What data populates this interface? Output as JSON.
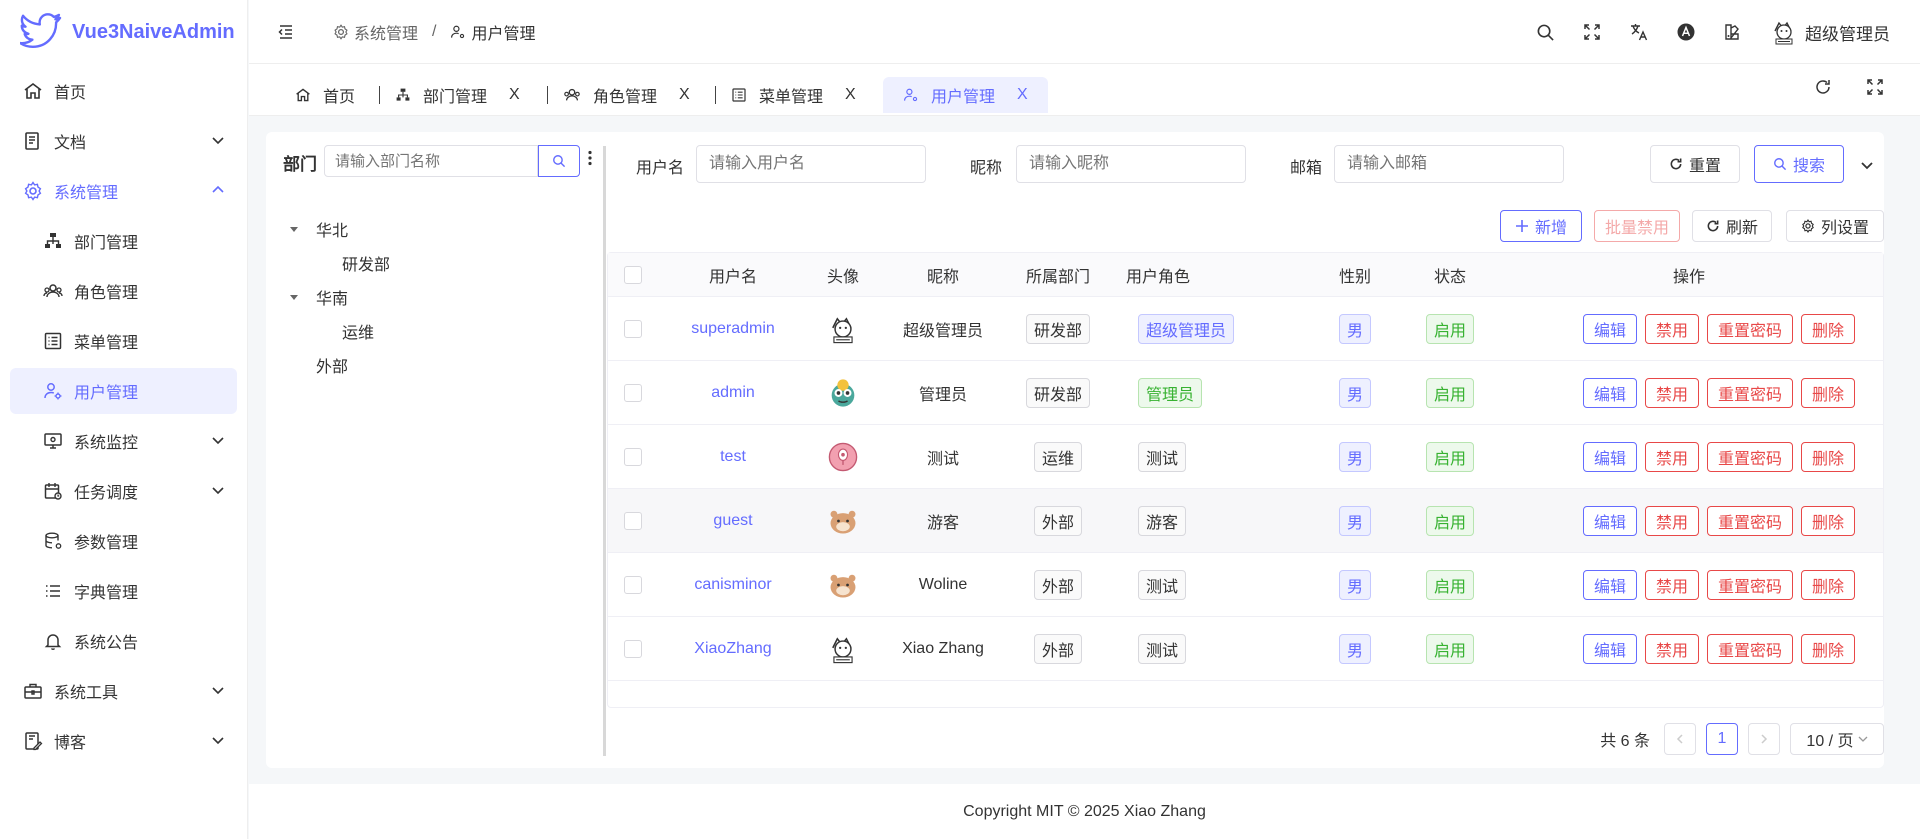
{
  "app": {
    "name": "Vue3NaiveAdmin",
    "brand_color": "#646cff"
  },
  "sidebar": {
    "items": [
      {
        "label": "首页",
        "icon": "home-icon"
      },
      {
        "label": "文档",
        "icon": "document-icon"
      },
      {
        "label": "系统管理",
        "icon": "gear-icon"
      },
      {
        "label": "部门管理",
        "icon": "org-icon"
      },
      {
        "label": "角色管理",
        "icon": "users-icon"
      },
      {
        "label": "菜单管理",
        "icon": "menu-list-icon"
      },
      {
        "label": "用户管理",
        "icon": "user-gear-icon"
      },
      {
        "label": "系统监控",
        "icon": "monitor-icon"
      },
      {
        "label": "任务调度",
        "icon": "calendar-icon"
      },
      {
        "label": "参数管理",
        "icon": "database-icon"
      },
      {
        "label": "字典管理",
        "icon": "list-icon"
      },
      {
        "label": "系统公告",
        "icon": "bell-icon"
      },
      {
        "label": "系统工具",
        "icon": "toolbox-icon"
      },
      {
        "label": "博客",
        "icon": "blog-icon"
      }
    ]
  },
  "header": {
    "breadcrumb": [
      "系统管理",
      "/",
      "用户管理"
    ],
    "user_name": "超级管理员"
  },
  "tabs": [
    {
      "label": "首页"
    },
    {
      "label": "部门管理",
      "close": "X"
    },
    {
      "label": "角色管理",
      "close": "X"
    },
    {
      "label": "菜单管理",
      "close": "X"
    },
    {
      "label": "用户管理",
      "close": "X"
    }
  ],
  "dept": {
    "title": "部门",
    "search_placeholder": "请输入部门名称",
    "tree": [
      "华北",
      "研发部",
      "华南",
      "运维",
      "外部"
    ]
  },
  "query": {
    "username_label": "用户名",
    "username_placeholder": "请输入用户名",
    "nickname_label": "昵称",
    "nickname_placeholder": "请输入昵称",
    "email_label": "邮箱",
    "email_placeholder": "请输入邮箱",
    "reset": "重置",
    "search": "搜索"
  },
  "toolbar": {
    "add": "新增",
    "batch_disable": "批量禁用",
    "refresh": "刷新",
    "column_settings": "列设置"
  },
  "table": {
    "headers": [
      "用户名",
      "头像",
      "昵称",
      "所属部门",
      "用户角色",
      "性别",
      "状态",
      "操作"
    ],
    "rows": [
      {
        "username": "superadmin",
        "nickname": "超级管理员",
        "dept": "研发部",
        "role": "超级管理员",
        "gender": "男",
        "status": "启用"
      },
      {
        "username": "admin",
        "nickname": "管理员",
        "dept": "研发部",
        "role": "管理员",
        "gender": "男",
        "status": "启用"
      },
      {
        "username": "test",
        "nickname": "测试",
        "dept": "运维",
        "role": "测试",
        "gender": "男",
        "status": "启用"
      },
      {
        "username": "guest",
        "nickname": "游客",
        "dept": "外部",
        "role": "游客",
        "gender": "男",
        "status": "启用"
      },
      {
        "username": "canisminor",
        "nickname": "Woline",
        "dept": "外部",
        "role": "测试",
        "gender": "男",
        "status": "启用"
      },
      {
        "username": "XiaoZhang",
        "nickname": "Xiao Zhang",
        "dept": "外部",
        "role": "测试",
        "gender": "男",
        "status": "启用"
      }
    ],
    "actions": {
      "edit": "编辑",
      "disable": "禁用",
      "reset_pwd": "重置密码",
      "delete": "删除"
    }
  },
  "pagination": {
    "total": "共 6 条",
    "current": "1",
    "page_size": "10 / 页"
  },
  "footer": {
    "text": "Copyright MIT © 2025 Xiao Zhang"
  }
}
